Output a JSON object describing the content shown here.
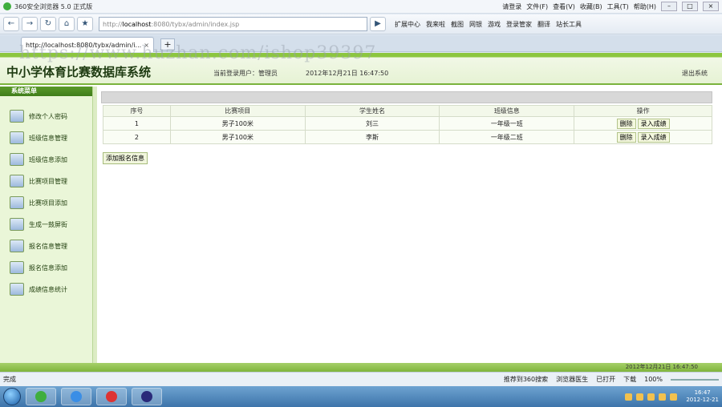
{
  "browser": {
    "title": "360安全浏览器 5.0 正式版",
    "menu": [
      "请登录",
      "文件(F)",
      "查看(V)",
      "收藏(B)",
      "工具(T)",
      "帮助(H)"
    ],
    "address_prefix": "http://",
    "address_host": "localhost",
    "address_rest": ":8080/tybx/admin/index.jsp",
    "toolbar": [
      "扩展中心",
      "我来啦",
      "截图",
      "网银",
      "游戏",
      "登录管家",
      "翻译",
      "站长工具"
    ],
    "tab_title": "http://localhost:8080/tybx/admin/i...",
    "tab_close": "×",
    "new_tab": "+"
  },
  "watermark": "https://www.huzhan.com/ishop39397",
  "app": {
    "title": "中小学体育比赛数据库系统",
    "user_label": "当前登录用户：管理员",
    "datetime": "2012年12月21日  16:47:50",
    "logout": "退出系统",
    "footer_time": "2012年12月21日  16:47:50"
  },
  "sidebar": {
    "header": "系统菜单",
    "items": [
      "修改个人密码",
      "班级信息管理",
      "班级信息添加",
      "比赛项目管理",
      "比赛项目添加",
      "生成一鼓屏街",
      "报名信息管理",
      "报名信息添加",
      "成绩信息统计"
    ]
  },
  "table": {
    "headers": [
      "序号",
      "比赛项目",
      "学生姓名",
      "班级信息",
      "操作"
    ],
    "rows": [
      {
        "no": "1",
        "event": "男子100米",
        "student": "刘三",
        "class": "一年级一班",
        "del": "删除",
        "score": "录入成绩"
      },
      {
        "no": "2",
        "event": "男子100米",
        "student": "李斯",
        "class": "一年级二班",
        "del": "删除",
        "score": "录入成绩"
      }
    ],
    "add_button": "添加报名信息"
  },
  "status": {
    "left": "完成",
    "recommend": "推荐到360搜索",
    "doctor": "浏览器医生",
    "open": "已打开",
    "download": "下载",
    "zoom": "100%"
  },
  "taskbar": {
    "time": "16:47",
    "date": "2012-12-21"
  }
}
